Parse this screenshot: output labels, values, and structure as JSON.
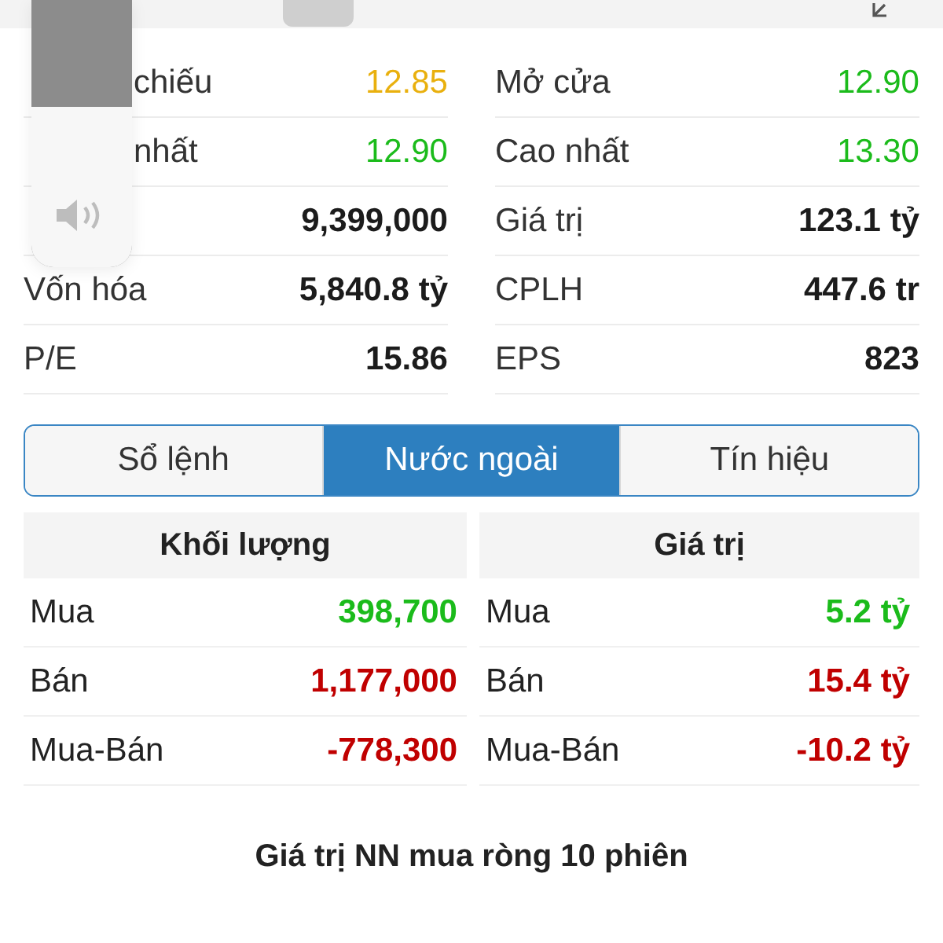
{
  "stats": [
    {
      "label": "chiếu",
      "label_covered": true,
      "value": "12.85",
      "kind": "price",
      "color": "#e9b00e"
    },
    {
      "label": "Mở cửa",
      "label_covered": false,
      "value": "12.90",
      "kind": "price",
      "color": "#1bbb1b"
    },
    {
      "label": "nhất",
      "label_covered": true,
      "value": "12.90",
      "kind": "price",
      "color": "#1bbb1b"
    },
    {
      "label": "Cao nhất",
      "label_covered": false,
      "value": "13.30",
      "kind": "price",
      "color": "#1bbb1b"
    },
    {
      "value": "9,399,000",
      "kind": "figure",
      "color": "#1c1c1c"
    },
    {
      "label": "Giá trị",
      "label_covered": false,
      "value": "123.1 tỷ",
      "kind": "figure",
      "color": "#1c1c1c"
    },
    {
      "label": "Vốn hóa",
      "label_covered": false,
      "value": "5,840.8 tỷ",
      "kind": "figure",
      "color": "#1c1c1c"
    },
    {
      "label": "CPLH",
      "label_covered": false,
      "value": "447.6 tr",
      "kind": "figure",
      "color": "#1c1c1c"
    },
    {
      "label": "P/E",
      "label_covered": false,
      "value": "15.86",
      "kind": "figure",
      "color": "#1c1c1c"
    },
    {
      "label": "EPS",
      "label_covered": false,
      "value": "823",
      "kind": "figure",
      "color": "#1c1c1c"
    }
  ],
  "volume_hud": {
    "level": 0.6
  },
  "tabs": [
    {
      "label": "Sổ lệnh",
      "selected": false
    },
    {
      "label": "Nước ngoài",
      "selected": true
    },
    {
      "label": "Tín hiệu",
      "selected": false
    }
  ],
  "foreign": {
    "columns": [
      {
        "title": "Khối lượng",
        "rows": [
          {
            "label": "Mua",
            "value": "398,700",
            "color": "#1bbb1b"
          },
          {
            "label": "Bán",
            "value": "1,177,000",
            "color": "#c00000"
          },
          {
            "label": "Mua-Bán",
            "value": "-778,300",
            "color": "#c00000"
          }
        ]
      },
      {
        "title": "Giá trị",
        "rows": [
          {
            "label": "Mua",
            "value": "5.2 tỷ",
            "color": "#1bbb1b"
          },
          {
            "label": "Bán",
            "value": "15.4 tỷ",
            "color": "#c00000"
          },
          {
            "label": "Mua-Bán",
            "value": "-10.2 tỷ",
            "color": "#c00000"
          }
        ]
      }
    ]
  },
  "chart_title": "Giá trị NN mua ròng 10 phiên"
}
